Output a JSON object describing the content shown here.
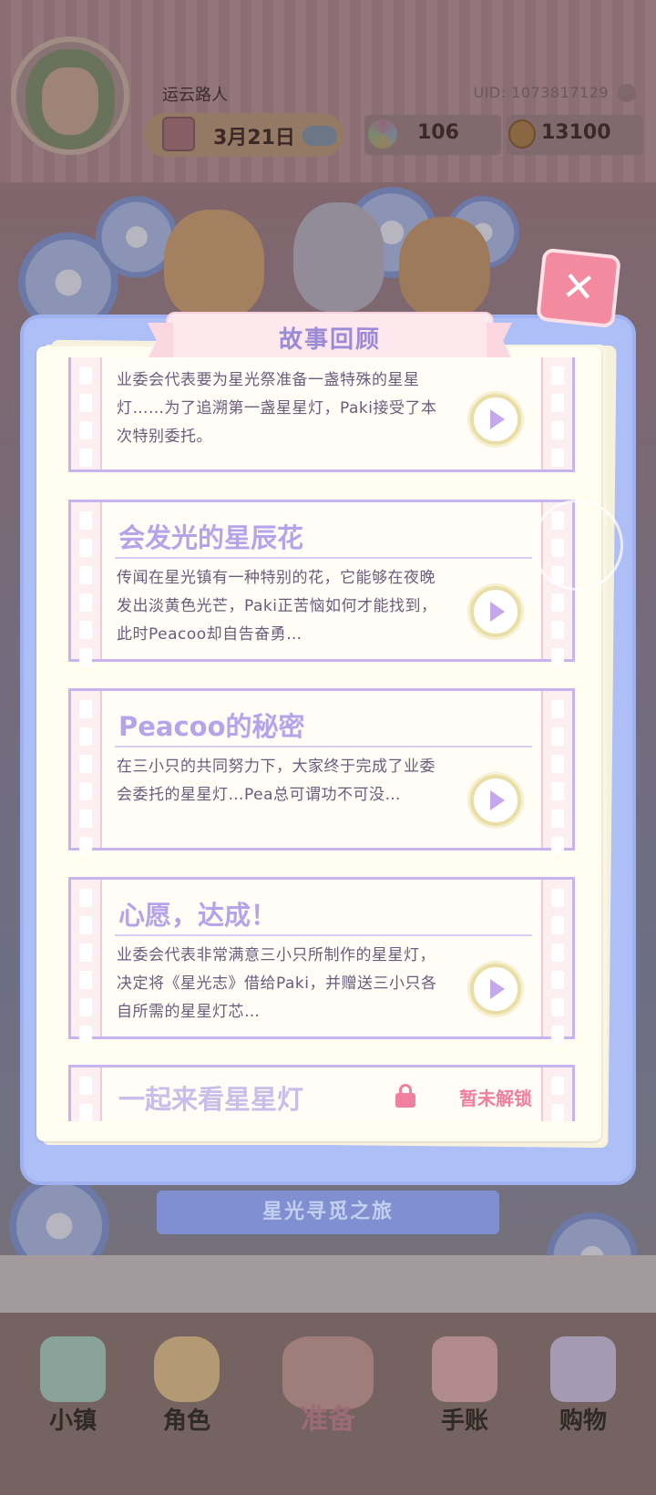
{
  "header": {
    "player_name": "运云路人",
    "uid": "UID: 1073817129",
    "date": "3月21日",
    "gems": "106",
    "coins": "13100"
  },
  "panel": {
    "title": "故事回顾",
    "close_label": "✕",
    "stories": [
      {
        "title": "",
        "description": "业委会代表要为星光祭准备一盏特殊的星星灯……为了追溯第一盏星星灯，Paki接受了本次特别委托。",
        "locked": false
      },
      {
        "title": "会发光的星辰花",
        "description": "传闻在星光镇有一种特别的花，它能够在夜晚发出淡黄色光芒，Paki正苦恼如何才能找到，此时Peacoo却自告奋勇…",
        "locked": false
      },
      {
        "title": "Peacoo的秘密",
        "description": "在三小只的共同努力下，大家终于完成了业委会委托的星星灯…Pea总可谓功不可没…",
        "locked": false
      },
      {
        "title": "心愿，达成！",
        "description": "业委会代表非常满意三小只所制作的星星灯，决定将《星光志》借给Paki，并赠送三小只各自所需的星星灯芯…",
        "locked": false
      },
      {
        "title": "一起来看星星灯",
        "lock_label": "暂未解锁",
        "locked": true
      }
    ]
  },
  "journey_banner": "星光寻觅之旅",
  "nav": {
    "items": [
      {
        "label": "小镇",
        "icon": "map-icon"
      },
      {
        "label": "角色",
        "icon": "character-icon"
      },
      {
        "label": "准备",
        "icon": "prepare-icon"
      },
      {
        "label": "手账",
        "icon": "journal-icon"
      },
      {
        "label": "购物",
        "icon": "shopping-bag-icon"
      }
    ]
  },
  "colors": {
    "panel_blue": "#aebef6",
    "title_lilac": "#b6a3ea",
    "lock_pink": "#f07fa0",
    "close_pink": "#f48aa0"
  }
}
